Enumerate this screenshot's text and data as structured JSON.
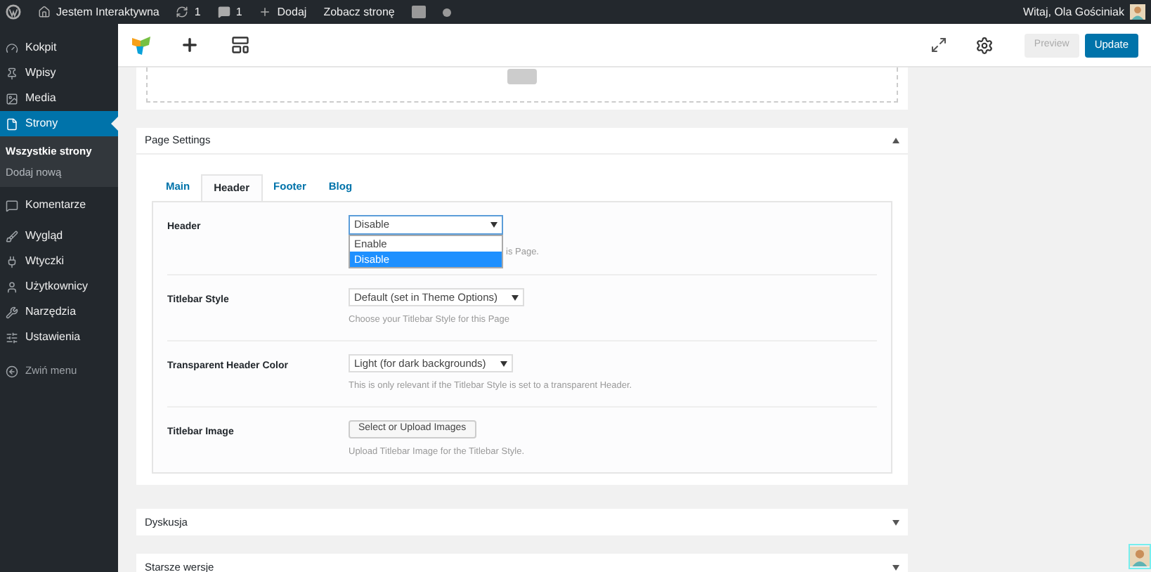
{
  "admin_bar": {
    "site": "Jestem Interaktywna",
    "updates": "1",
    "comments": "1",
    "add": "Dodaj",
    "view": "Zobacz stronę",
    "greeting": "Witaj, Ola Gościniak"
  },
  "sidebar": {
    "items": [
      {
        "label": "Kokpit",
        "selected": false
      },
      {
        "label": "Wpisy",
        "selected": false
      },
      {
        "label": "Media",
        "selected": false
      },
      {
        "label": "Strony",
        "selected": true,
        "children": [
          {
            "label": "Wszystkie strony",
            "selected": true
          },
          {
            "label": "Dodaj nową",
            "selected": false
          }
        ]
      },
      {
        "label": "Komentarze",
        "selected": false
      },
      {
        "label": "Wygląd",
        "selected": false
      },
      {
        "label": "Wtyczki",
        "selected": false
      },
      {
        "label": "Użytkownicy",
        "selected": false
      },
      {
        "label": "Narzędzia",
        "selected": false
      },
      {
        "label": "Ustawienia",
        "selected": false
      }
    ],
    "collapse": "Zwiń menu"
  },
  "toolbar": {
    "preview": "Preview",
    "update": "Update"
  },
  "page_settings": {
    "title": "Page Settings",
    "expanded": true,
    "tabs": [
      {
        "label": "Main",
        "selected": false
      },
      {
        "label": "Header",
        "selected": true
      },
      {
        "label": "Footer",
        "selected": false
      },
      {
        "label": "Blog",
        "selected": false
      }
    ],
    "fields": [
      {
        "kind": "select",
        "label": "Header",
        "value": "Disable",
        "hint": "is Page.",
        "open": true,
        "options": [
          {
            "label": "Enable",
            "selected": false
          },
          {
            "label": "Disable",
            "selected": true
          }
        ]
      },
      {
        "kind": "select",
        "label": "Titlebar Style",
        "value": "Default (set in Theme Options)",
        "hint": "Choose your Titlebar Style for this Page",
        "open": false
      },
      {
        "kind": "select",
        "label": "Transparent Header Color",
        "value": "Light (for dark backgrounds)",
        "hint": "This is only relevant if the Titlebar Style is set to a transparent Header.",
        "open": false
      },
      {
        "kind": "button",
        "label": "Titlebar Image",
        "value": "Select or Upload Images",
        "hint": "Upload Titlebar Image for the Titlebar Style."
      }
    ]
  },
  "panels": [
    {
      "title": "Dyskusja",
      "expanded": false
    },
    {
      "title": "Starsze wersje",
      "expanded": false
    }
  ]
}
